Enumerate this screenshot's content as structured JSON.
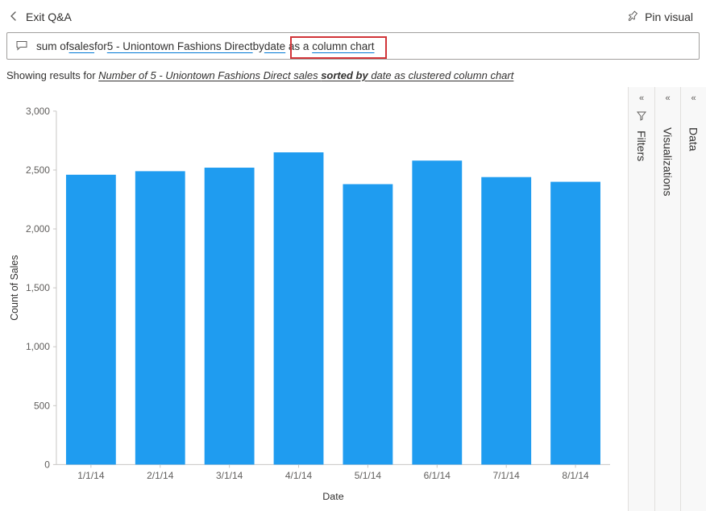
{
  "header": {
    "back_label": "Exit Q&A",
    "pin_label": "Pin visual"
  },
  "query": {
    "pre1": "sum of ",
    "u1": "sales",
    "pre2": " for ",
    "u2": "5 - Uniontown Fashions Direct",
    "pre3": " by ",
    "u3": "date",
    "pre4": " as a ",
    "u4": "column chart"
  },
  "results": {
    "prefix": "Showing results for ",
    "part1": "Number of 5 - Uniontown Fashions Direct sales ",
    "bold1": "sorted by",
    "part2": " date as clustered column chart"
  },
  "panes": {
    "filters": "Filters",
    "visualizations": "Visualizations",
    "data": "Data"
  },
  "chart_data": {
    "type": "bar",
    "title": "",
    "xlabel": "Date",
    "ylabel": "Count of Sales",
    "ylim": [
      0,
      3000
    ],
    "yticks": [
      0,
      500,
      1000,
      1500,
      2000,
      2500,
      3000
    ],
    "ytick_labels": [
      "0",
      "500",
      "1,000",
      "1,500",
      "2,000",
      "2,500",
      "3,000"
    ],
    "categories": [
      "1/1/14",
      "2/1/14",
      "3/1/14",
      "4/1/14",
      "5/1/14",
      "6/1/14",
      "7/1/14",
      "8/1/14"
    ],
    "values": [
      2460,
      2490,
      2520,
      2650,
      2380,
      2580,
      2440,
      2400
    ]
  }
}
